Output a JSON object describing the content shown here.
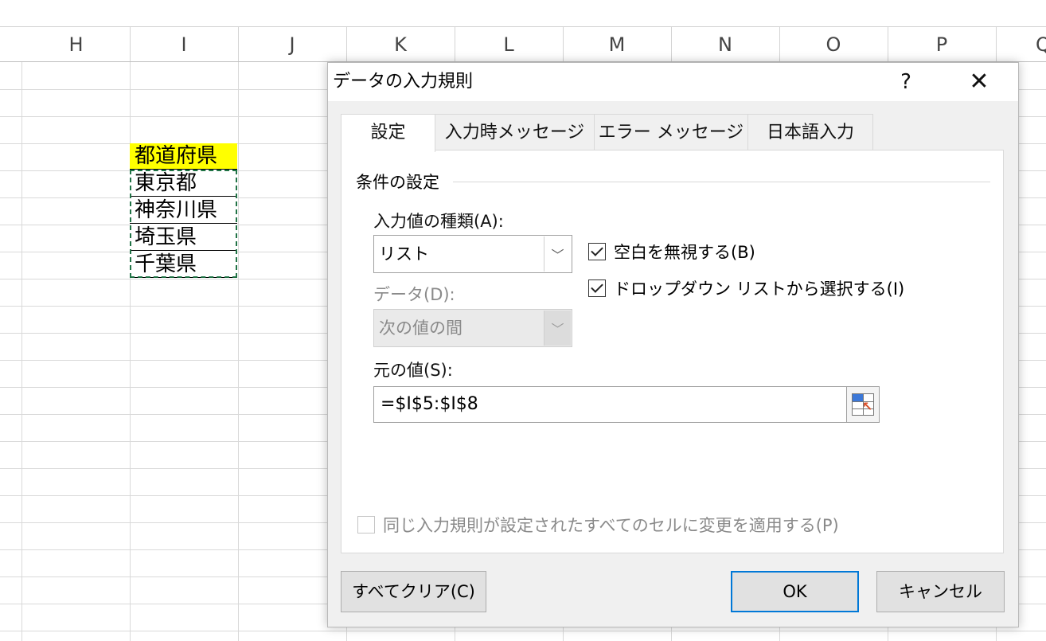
{
  "sheet": {
    "columns": [
      "H",
      "I",
      "J",
      "K",
      "L",
      "M",
      "N",
      "O",
      "P",
      "Q"
    ],
    "cells": {
      "header": "都道府県",
      "items": [
        "東京都",
        "神奈川県",
        "埼玉県",
        "千葉県"
      ]
    }
  },
  "dialog": {
    "title": "データの入力規則",
    "help": "?",
    "close": "✕",
    "tabs": [
      "設定",
      "入力時メッセージ",
      "エラー メッセージ",
      "日本語入力"
    ],
    "active_tab": "設定",
    "group_label": "条件の設定",
    "allow_label": "入力値の種類(A):",
    "allow_value": "リスト",
    "data_label": "データ(D):",
    "data_value": "次の値の間",
    "ignore_blank": {
      "label": "空白を無視する(B)",
      "checked": true
    },
    "in_cell_dropdown": {
      "label": "ドロップダウン リストから選択する(I)",
      "checked": true
    },
    "source_label": "元の値(S):",
    "source_value": "=$I$5:$I$8",
    "apply_all": {
      "label": "同じ入力規則が設定されたすべてのセルに変更を適用する(P)",
      "checked": false,
      "disabled": true
    },
    "clear_all_label": "すべてクリア(C)",
    "ok_label": "OK",
    "cancel_label": "キャンセル"
  },
  "icons": {
    "dropdown": "chevron-down-icon",
    "range": "range-selector-icon"
  },
  "colors": {
    "header_fill": "#ffff00",
    "marquee": "#217346",
    "focus": "#0078d7"
  }
}
